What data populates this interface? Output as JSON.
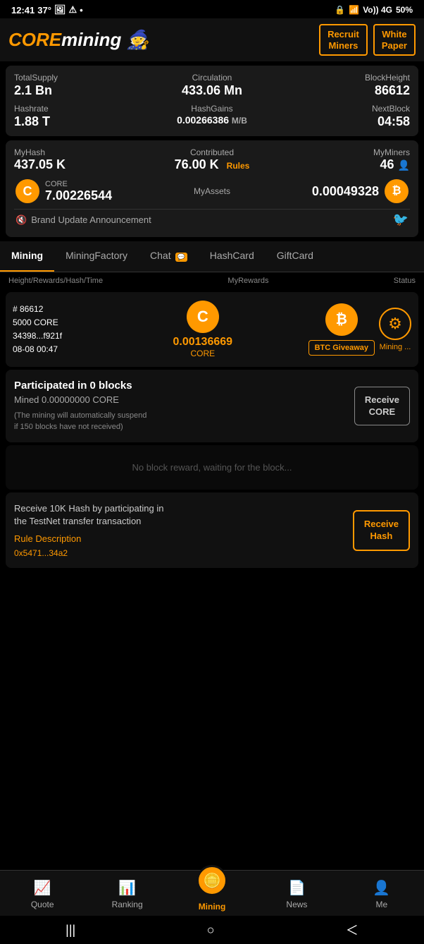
{
  "statusBar": {
    "time": "12:41",
    "temp": "37°",
    "battery": "50%"
  },
  "header": {
    "logoCore": "CORE",
    "logoMining": "mining",
    "recruitBtn": "Recruit\nMiners",
    "whitepaperBtn": "White\nPaper"
  },
  "stats": {
    "totalSupplyLabel": "TotalSupply",
    "totalSupplyValue": "2.1 Bn",
    "circulationLabel": "Circulation",
    "circulationValue": "433.06 Mn",
    "blockHeightLabel": "BlockHeight",
    "blockHeightValue": "86612",
    "hashrateLabel": "Hashrate",
    "hashrateValue": "1.88 T",
    "hashGainsLabel": "HashGains",
    "hashGainsValue": "0.00266386",
    "hashGainsUnit": "M/B",
    "nextBlockLabel": "NextBlock",
    "nextBlockValue": "04:58"
  },
  "myHash": {
    "myHashLabel": "MyHash",
    "myHashValue": "437.05 K",
    "contributedLabel": "Contributed",
    "contributedValue": "76.00 K",
    "rulesLink": "Rules",
    "myMinersLabel": "MyMiners",
    "myMinersValue": "46"
  },
  "assets": {
    "coreName": "CORE",
    "coreValue": "7.00226544",
    "myAssetsLabel": "MyAssets",
    "btcValue": "0.00049328",
    "btcName": "BTC"
  },
  "announcement": {
    "text": "Brand Update Announcement"
  },
  "tabs": [
    {
      "label": "Mining",
      "active": true,
      "badge": ""
    },
    {
      "label": "MiningFactory",
      "active": false,
      "badge": ""
    },
    {
      "label": "Chat",
      "active": false,
      "badge": "💬"
    },
    {
      "label": "HashCard",
      "active": false,
      "badge": ""
    },
    {
      "label": "GiftCard",
      "active": false,
      "badge": ""
    }
  ],
  "miningTableHeader": {
    "col1": "Height/Rewards/Hash/Time",
    "col2": "MyRewards",
    "col3": "Status"
  },
  "miningRow": {
    "height": "# 86612",
    "rewards": "5000 CORE",
    "hash": "34398...f921f",
    "time": "08-08 00:47",
    "rewardAmount": "0.00136669",
    "rewardCoin": "CORE",
    "btcGiveaway": "BTC Giveaway",
    "statusText": "Mining ..."
  },
  "participated": {
    "title": "Participated in 0 blocks",
    "mined": "Mined 0.00000000 CORE",
    "note": "(The mining will automatically suspend\nif 150 blocks have not received)",
    "btnLine1": "Receive",
    "btnLine2": "CORE"
  },
  "noReward": {
    "text": "No block reward, waiting for the block..."
  },
  "testnet": {
    "title": "Receive 10K Hash by participating in\nthe TestNet transfer transaction",
    "ruleLink": "Rule Description",
    "address": "0x5471...34a2",
    "btnLine1": "Receive",
    "btnLine2": "Hash"
  },
  "bottomNav": [
    {
      "label": "Quote",
      "icon": "📈",
      "active": false,
      "id": "quote"
    },
    {
      "label": "Ranking",
      "icon": "📊",
      "active": false,
      "id": "ranking"
    },
    {
      "label": "Mining",
      "icon": "🪙",
      "active": true,
      "id": "mining"
    },
    {
      "label": "News",
      "icon": "📄",
      "active": false,
      "id": "news"
    },
    {
      "label": "Me",
      "icon": "👤",
      "active": false,
      "id": "me"
    }
  ],
  "androidNav": {
    "menu": "|||",
    "home": "○",
    "back": "＜"
  }
}
